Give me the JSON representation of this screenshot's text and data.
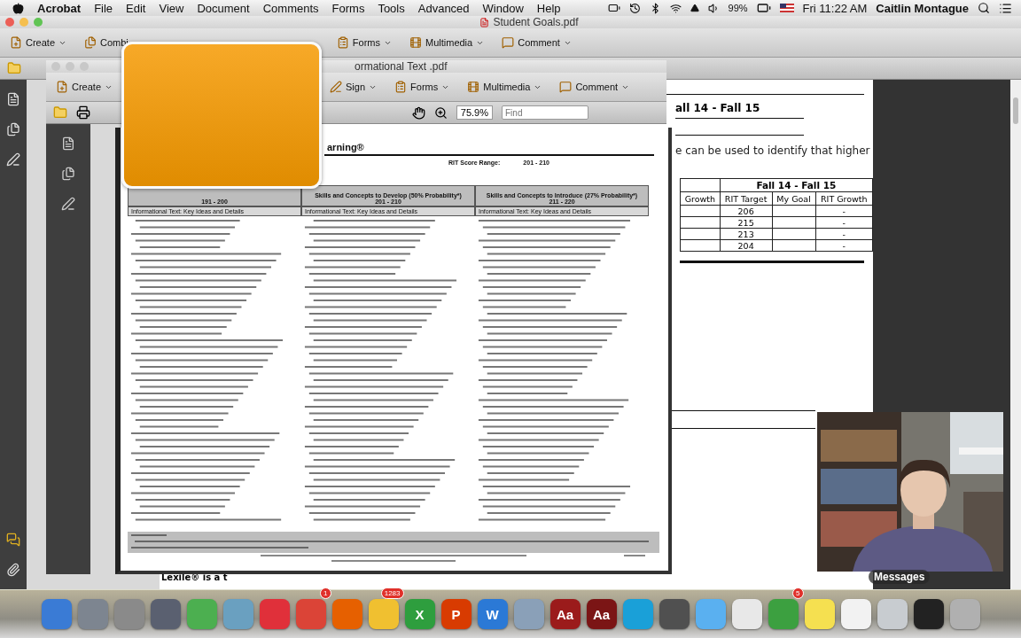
{
  "menu_bar": {
    "app": "Acrobat",
    "menus": [
      "File",
      "Edit",
      "View",
      "Document",
      "Comments",
      "Forms",
      "Tools",
      "Advanced",
      "Window",
      "Help"
    ],
    "battery": "99%",
    "clock": "Fri 11:22 AM",
    "user": "Caitlin Montague"
  },
  "main_window": {
    "title": "Student Goals.pdf",
    "toolbar": [
      {
        "label": "Create"
      },
      {
        "label": "Combi"
      },
      {
        "label": "Forms"
      },
      {
        "label": "Multimedia"
      },
      {
        "label": "Comment"
      }
    ],
    "document": {
      "heading": "all 14 - Fall 15",
      "sentence": "e can be used to identify that higher",
      "table": {
        "group_header": "Fall 14 - Fall 15",
        "columns": [
          "Growth",
          "RIT Target",
          "My Goal",
          "RIT Growth"
        ],
        "rows": [
          [
            "",
            "206",
            "",
            "-"
          ],
          [
            "",
            "215",
            "",
            "-"
          ],
          [
            "",
            "213",
            "",
            "-"
          ],
          [
            "",
            "204",
            "",
            "-"
          ]
        ]
      },
      "footer": "Lexile® is a t"
    }
  },
  "front_window": {
    "title": "ormational Text .pdf",
    "toolbar": [
      {
        "label": "Create"
      },
      {
        "label": "Sign"
      },
      {
        "label": "Forms"
      },
      {
        "label": "Multimedia"
      },
      {
        "label": "Comment"
      }
    ],
    "zoom": "75.9%",
    "find": {
      "placeholder": "Find"
    },
    "page": {
      "title": "arning®",
      "score_label": "RIT Score Range:",
      "score_value": "201 - 210",
      "columns": [
        {
          "range": "191 - 200",
          "subhead": "Informational Text: Key Ideas and Details"
        },
        {
          "title": "Skills and Concepts to Develop (50% Probability*)",
          "range": "201 - 210",
          "subhead": "Informational Text: Key Ideas and Details"
        },
        {
          "title": "Skills and Concepts to Introduce (27% Probability*)",
          "range": "211 - 220",
          "subhead": "Informational Text: Key Ideas and Details"
        }
      ]
    }
  },
  "webcam": {
    "caption": "Messages"
  },
  "dock": {
    "apps": [
      {
        "color": "#3a7bd5"
      },
      {
        "color": "#7d8590"
      },
      {
        "color": "#8a8a8a"
      },
      {
        "color": "#5a6070"
      },
      {
        "color": "#4caf50"
      },
      {
        "color": "#6aa0c0"
      },
      {
        "color": "#e0303a"
      },
      {
        "color": "#db4437",
        "badge": "1"
      },
      {
        "color": "#e66000"
      },
      {
        "color": "#f0c030",
        "badge": "1283"
      },
      {
        "color": "#2e9e3e",
        "glyph": "X"
      },
      {
        "color": "#d83b01",
        "glyph": "P"
      },
      {
        "color": "#2b79d6",
        "glyph": "W"
      },
      {
        "color": "#8aa0b8"
      },
      {
        "color": "#9b1b1b",
        "glyph": "Aa"
      },
      {
        "color": "#7b1515",
        "glyph": "Aa"
      },
      {
        "color": "#1aa0d8"
      },
      {
        "color": "#505050"
      },
      {
        "color": "#5ab0f0"
      },
      {
        "color": "#e8e8e8"
      },
      {
        "color": "#3ca040",
        "badge": "5"
      },
      {
        "color": "#f5e050"
      },
      {
        "color": "#f2f2f2"
      },
      {
        "color": "#c8ccd0"
      },
      {
        "color": "#222222"
      },
      {
        "color": "#b0b0b0"
      }
    ]
  }
}
